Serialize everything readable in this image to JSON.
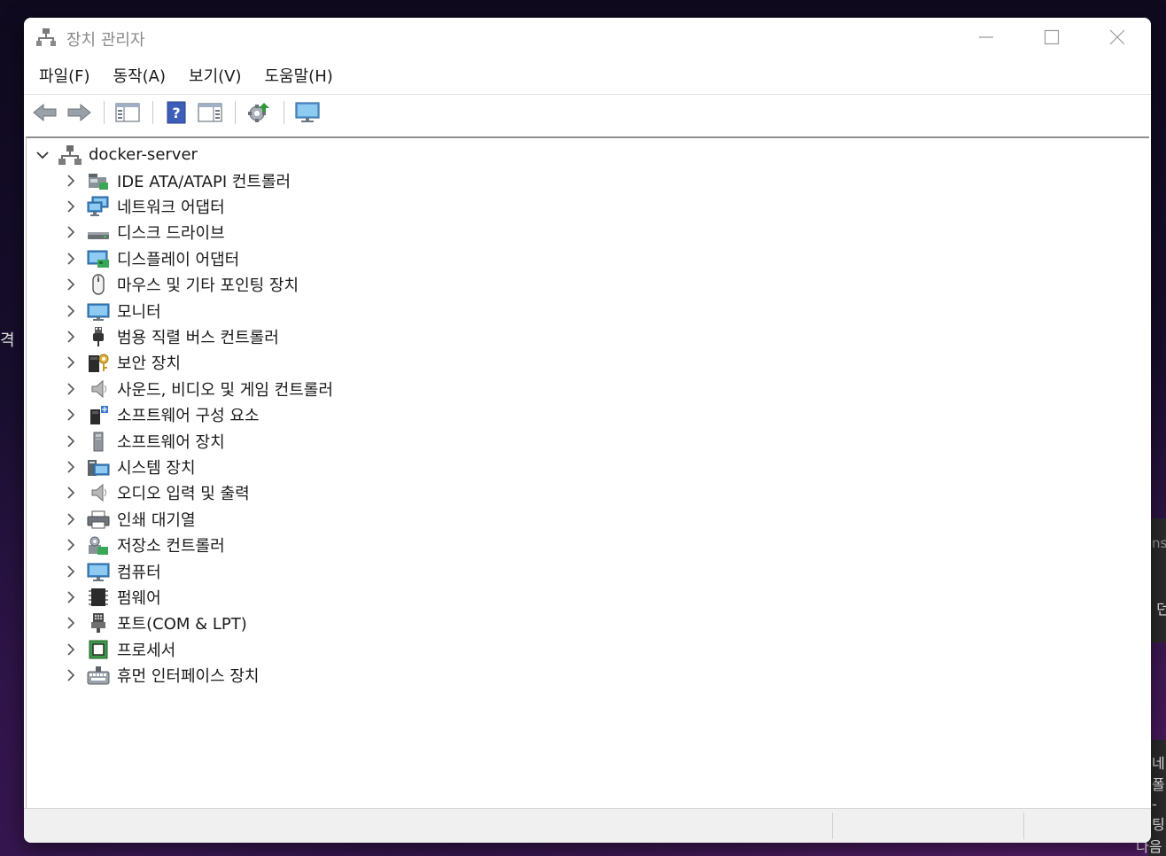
{
  "window": {
    "title": "장치 관리자"
  },
  "menu": [
    {
      "label": "파일(F)"
    },
    {
      "label": "동작(A)"
    },
    {
      "label": "보기(V)"
    },
    {
      "label": "도움말(H)"
    }
  ],
  "tree": {
    "root": "docker-server",
    "items": [
      {
        "label": "IDE ATA/ATAPI 컨트롤러",
        "icon": "ide-controller-icon"
      },
      {
        "label": "네트워크 어댑터",
        "icon": "network-adapter-icon"
      },
      {
        "label": "디스크 드라이브",
        "icon": "disk-drive-icon"
      },
      {
        "label": "디스플레이 어댑터",
        "icon": "display-adapter-icon"
      },
      {
        "label": "마우스 및 기타 포인팅 장치",
        "icon": "mouse-icon"
      },
      {
        "label": "모니터",
        "icon": "monitor-icon"
      },
      {
        "label": "범용 직렬 버스 컨트롤러",
        "icon": "usb-icon"
      },
      {
        "label": "보안 장치",
        "icon": "security-device-icon"
      },
      {
        "label": "사운드, 비디오 및 게임 컨트롤러",
        "icon": "speaker-icon"
      },
      {
        "label": "소프트웨어 구성 요소",
        "icon": "software-component-icon"
      },
      {
        "label": "소프트웨어 장치",
        "icon": "software-device-icon"
      },
      {
        "label": "시스템 장치",
        "icon": "system-device-icon"
      },
      {
        "label": "오디오 입력 및 출력",
        "icon": "audio-io-icon"
      },
      {
        "label": "인쇄 대기열",
        "icon": "printer-icon"
      },
      {
        "label": "저장소 컨트롤러",
        "icon": "storage-controller-icon"
      },
      {
        "label": "컴퓨터",
        "icon": "computer-icon"
      },
      {
        "label": "펌웨어",
        "icon": "firmware-icon"
      },
      {
        "label": "포트(COM & LPT)",
        "icon": "port-icon"
      },
      {
        "label": "프로세서",
        "icon": "processor-icon"
      },
      {
        "label": "휴먼 인터페이스 장치",
        "icon": "hid-icon"
      }
    ]
  },
  "desktop": {
    "frag_left": "격",
    "frag_right_1": "ns",
    "frag_right_2": "던",
    "frag_right_3": "네폴",
    "frag_right_4": "-팅",
    "frag_right_5": "다음"
  }
}
